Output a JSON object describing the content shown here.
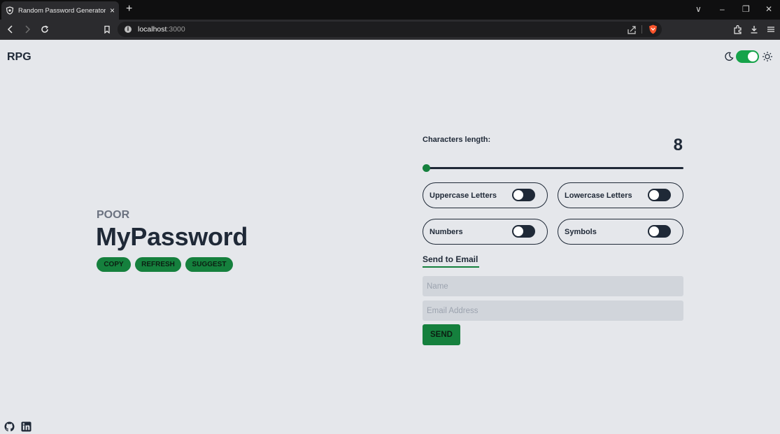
{
  "browser": {
    "tab_title": "Random Password Generator To",
    "tab_close": "×",
    "new_tab": "+",
    "url_host": "localhost",
    "url_port": ":3000",
    "window_controls": [
      "∨",
      "–",
      "❐",
      "✕"
    ],
    "nav_icons": [
      "back-icon",
      "forward-icon",
      "reload-icon",
      "bookmark-icon"
    ],
    "accent": "#fb542b"
  },
  "header": {
    "brand": "RPG",
    "theme_toggle_on": true,
    "icons": [
      "moon-icon",
      "sun-icon"
    ]
  },
  "password": {
    "strength": "POOR",
    "value": "MyPassword",
    "actions": [
      "COPY",
      "REFRESH",
      "SUGGEST"
    ]
  },
  "settings": {
    "length_label": "Characters length:",
    "length_value": "8",
    "slider_fraction": 0.0,
    "options": [
      {
        "label": "Uppercase Letters",
        "on": false
      },
      {
        "label": "Lowercase Letters",
        "on": false
      },
      {
        "label": "Numbers",
        "on": false
      },
      {
        "label": "Symbols",
        "on": false
      }
    ]
  },
  "email": {
    "heading": "Send to Email",
    "name_placeholder": "Name",
    "email_placeholder": "Email Address",
    "send_label": "SEND"
  },
  "footer": {
    "icons": [
      "github-icon",
      "linkedin-icon"
    ]
  },
  "colors": {
    "accent_green": "#15803d",
    "toggle_on": "#16a34a",
    "text_dark": "#1f2937",
    "page_bg": "#e5e7eb"
  }
}
